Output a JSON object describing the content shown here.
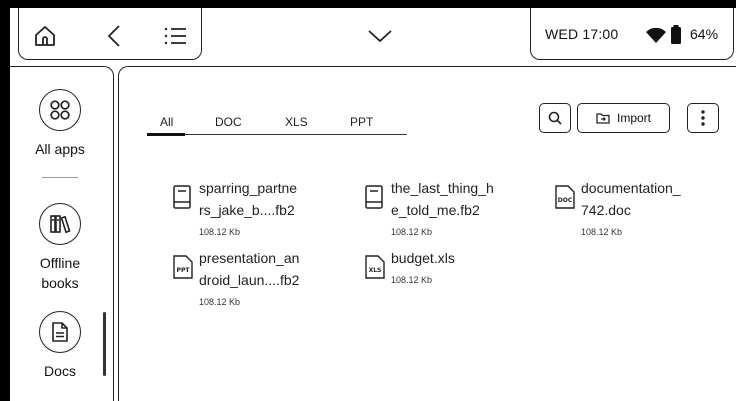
{
  "status": {
    "datetime": "WED 17:00",
    "battery": "64%"
  },
  "sidebar": {
    "items": [
      {
        "label": "All apps"
      },
      {
        "label": "Offline books"
      },
      {
        "label": "Docs"
      }
    ]
  },
  "tabs": [
    "All",
    "DOC",
    "XLS",
    "PPT"
  ],
  "toolbar": {
    "import_label": "Import"
  },
  "files": [
    {
      "name_line1": "sparring_partne",
      "name_line2": "rs_jake_b....fb2",
      "size": "108.12 Kb",
      "type": "book"
    },
    {
      "name_line1": "the_last_thing_h",
      "name_line2": "e_told_me.fb2",
      "size": "108.12 Kb",
      "type": "book"
    },
    {
      "name_line1": "documentation_",
      "name_line2": "742.doc",
      "size": "108.12 Kb",
      "type": "doc",
      "badge": "DOC"
    },
    {
      "name_line1": "presentation_an",
      "name_line2": "droid_laun....fb2",
      "size": "108.12 Kb",
      "type": "ppt",
      "badge": "PPT"
    },
    {
      "name_line1": "budget.xls",
      "name_line2": "",
      "size": "108.12 Kb",
      "type": "xls",
      "badge": "XLS"
    }
  ]
}
